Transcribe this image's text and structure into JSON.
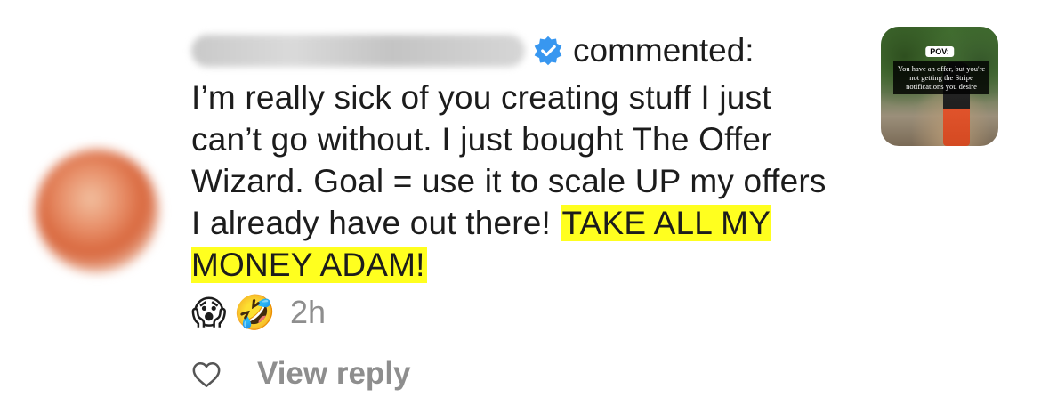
{
  "comment": {
    "action_text": "commented:",
    "body_text": "I’m really sick of you creating stuff I just can’t go without. I just bought The Offer Wizard. Goal = use it to scale UP my offers I already have out there! ",
    "highlighted_text": "TAKE ALL MY MONEY ADAM!",
    "emojis": [
      "😱",
      "🤣"
    ],
    "time": "2h"
  },
  "actions": {
    "view_reply_label": "View reply"
  },
  "thumbnail": {
    "pov_label": "POV:",
    "overlay_text": "You have an offer, but you're not getting the Stripe notifications you desire"
  },
  "colors": {
    "highlight": "#ffff1f",
    "verified_badge": "#3897f0",
    "muted_text": "#8e8e8e"
  },
  "icons": {
    "verified": "verified-badge-icon",
    "like": "heart-outline-icon"
  }
}
